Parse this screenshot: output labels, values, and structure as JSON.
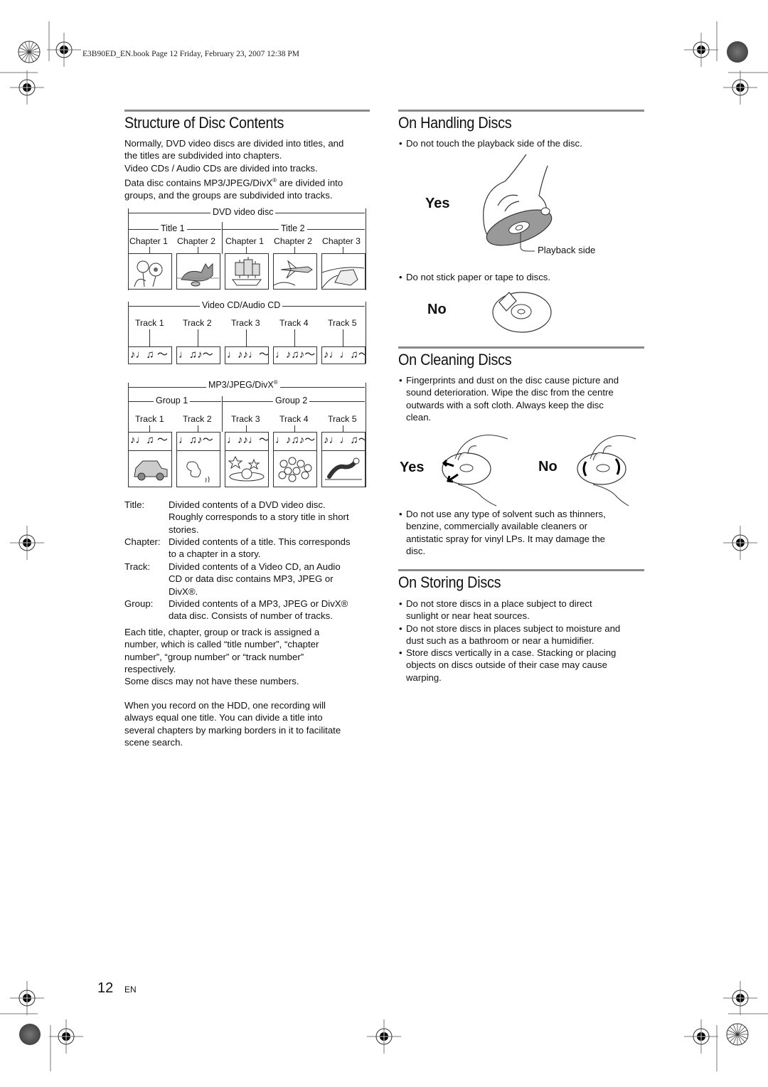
{
  "header": {
    "print_line": "E3B90ED_EN.book  Page 12  Friday, February 23, 2007  12:38 PM"
  },
  "structure": {
    "title": "Structure of Disc Contents",
    "intro_lines": [
      "Normally, DVD video discs are divided into titles, and",
      "the titles are subdivided into chapters.",
      "Video CDs / Audio CDs are divided into tracks.",
      "Data disc contains MP3/JPEG/DivX",
      "groups, and the groups are subdivided into tracks."
    ],
    "intro_line4_suffix": " are divided into",
    "registered": "®",
    "dvd_diagram": {
      "label": "DVD video disc",
      "title1": "Title 1",
      "title2": "Title 2",
      "chapters": [
        "Chapter 1",
        "Chapter 2",
        "Chapter 1",
        "Chapter 2",
        "Chapter 3"
      ],
      "images": [
        "sunflowers",
        "cat",
        "sailing-ship",
        "airplane",
        "car-on-road"
      ]
    },
    "cd_diagram": {
      "label": "Video CD/Audio CD",
      "tracks": [
        "Track 1",
        "Track 2",
        "Track 3",
        "Track 4",
        "Track 5"
      ],
      "notes": [
        "♪♩♫ ～",
        "♩♫♪～",
        "♩♪♪♩～",
        "♩♪♫♪～",
        "♪♩♩♫～"
      ]
    },
    "mp3_diagram": {
      "label": "MP3/JPEG/DivX",
      "group1": "Group 1",
      "group2": "Group 2",
      "tracks": [
        "Track 1",
        "Track 2",
        "Track 3",
        "Track 4",
        "Track 5"
      ],
      "notes": [
        "♪♩♫ ～",
        "♩♫♪～",
        "♩♪♪♩～",
        "♩♪♫♪～",
        "♪♩♩♫～"
      ],
      "images": [
        "car",
        "butterfly",
        "planet-stars",
        "flowers",
        "caterpillar"
      ]
    },
    "definitions": [
      {
        "term": "Title:",
        "lines": [
          "Divided contents of a DVD video disc.",
          "Roughly corresponds to a story title in short",
          "stories."
        ]
      },
      {
        "term": "Chapter:",
        "lines": [
          "Divided contents of a title. This corresponds",
          "to a chapter in a story."
        ]
      },
      {
        "term": "Track:",
        "lines": [
          "Divided contents of a Video CD, an Audio",
          "CD or data disc contains MP3, JPEG or",
          "DivX®."
        ]
      },
      {
        "term": "Group:",
        "lines": [
          "Divided contents of a MP3, JPEG or DivX®",
          "data disc. Consists of number of tracks."
        ]
      }
    ],
    "numbering_lines": [
      "Each title, chapter, group or track is assigned a",
      "number, which is called “title number”, “chapter",
      "number”, “group number” or “track number”",
      "respectively.",
      "Some discs may not have these numbers."
    ],
    "hdd_lines": [
      "When you record on the HDD, one recording will",
      "always equal one title. You can divide a title into",
      "several chapters by marking borders in it to facilitate",
      "scene search."
    ]
  },
  "handling": {
    "title": "On Handling Discs",
    "bullet1": "Do not touch the playback side of the disc.",
    "yes": "Yes",
    "playback_side": "Playback side",
    "bullet2": "Do not stick paper or tape to discs.",
    "no": "No"
  },
  "cleaning": {
    "title": "On Cleaning Discs",
    "bullet1_lines": [
      "Fingerprints and dust on the disc cause picture and",
      "sound deterioration. Wipe the disc from the centre",
      "outwards with a soft cloth. Always keep the disc",
      "clean."
    ],
    "yes": "Yes",
    "no": "No",
    "bullet2_lines": [
      "Do not use any type of solvent such as thinners,",
      "benzine, commercially available cleaners or",
      "antistatic spray for vinyl LPs. It may damage the",
      "disc."
    ]
  },
  "storing": {
    "title": "On Storing Discs",
    "bullets": [
      [
        "Do not store discs in a place subject to direct",
        "sunlight or near heat sources."
      ],
      [
        "Do not store discs in places subject to moisture and",
        "dust such as a bathroom or near a humidifier."
      ],
      [
        "Store discs vertically in a case. Stacking or placing",
        "objects on discs outside of their case may cause",
        "warping."
      ]
    ]
  },
  "footer": {
    "page_number": "12",
    "language": "EN"
  },
  "bullet_char": "•"
}
